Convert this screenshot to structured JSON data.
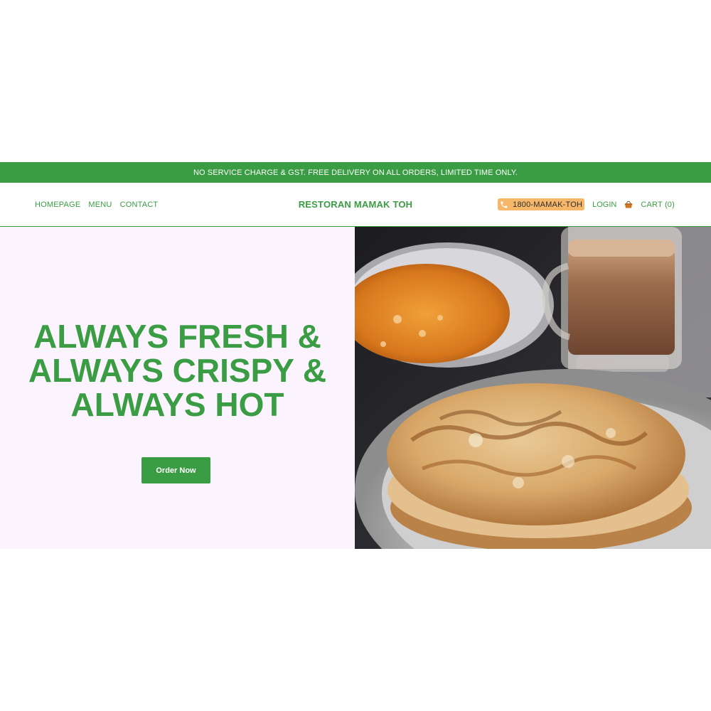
{
  "banner": {
    "text": "NO SERVICE CHARGE & GST. FREE DELIVERY ON ALL ORDERS, LIMITED TIME ONLY."
  },
  "nav": {
    "links": [
      {
        "label": "HOMEPAGE"
      },
      {
        "label": "MENU"
      },
      {
        "label": "CONTACT"
      }
    ],
    "brand": "RESTORAN MAMAK TOH",
    "phone": "1800-MAMAK-TOH",
    "login": "LOGIN",
    "cart": "CART (0)"
  },
  "hero": {
    "title_lines": [
      "ALWAYS FRESH &",
      "ALWAYS CRISPY &",
      "ALWAYS HOT"
    ],
    "cta": "Order Now",
    "image_icon": "roti-canai-teh-tarik-photo"
  },
  "colors": {
    "brand_green": "#3a9d43",
    "hero_bg": "#fbf3fd",
    "phone_pill": "#f6b76b"
  },
  "icons": {
    "phone": "phone-icon",
    "cart": "basket-icon"
  }
}
